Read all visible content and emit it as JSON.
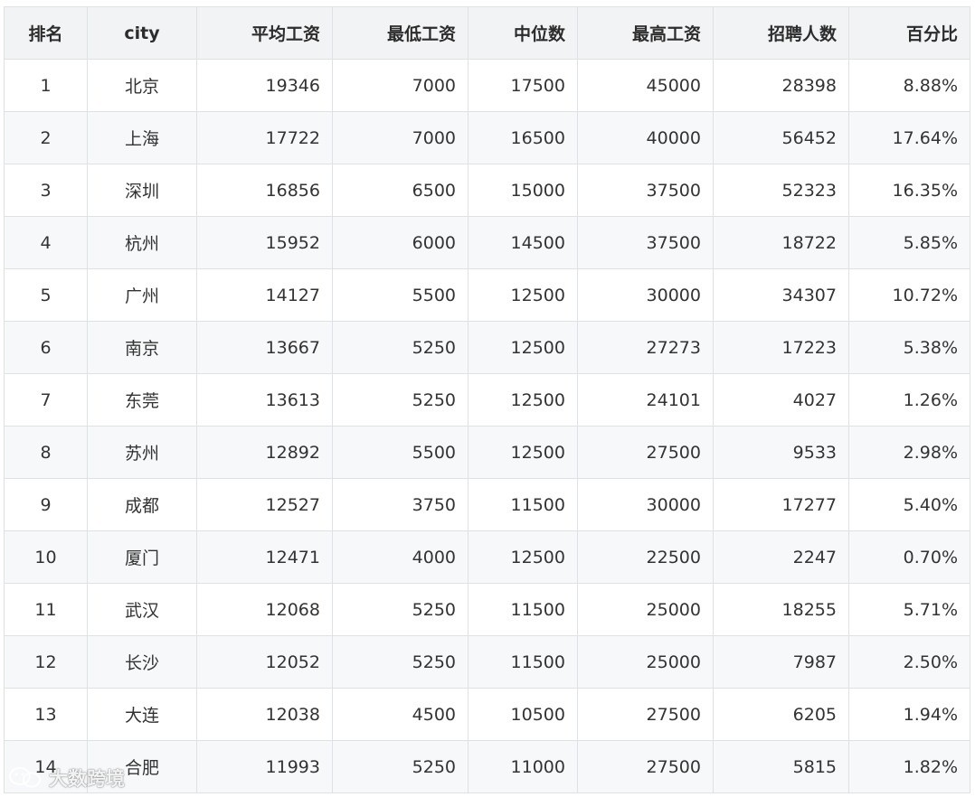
{
  "table": {
    "headers": [
      "排名",
      "city",
      "平均工资",
      "最低工资",
      "中位数",
      "最高工资",
      "招聘人数",
      "百分比"
    ],
    "rows": [
      [
        "1",
        "北京",
        "19346",
        "7000",
        "17500",
        "45000",
        "28398",
        "8.88%"
      ],
      [
        "2",
        "上海",
        "17722",
        "7000",
        "16500",
        "40000",
        "56452",
        "17.64%"
      ],
      [
        "3",
        "深圳",
        "16856",
        "6500",
        "15000",
        "37500",
        "52323",
        "16.35%"
      ],
      [
        "4",
        "杭州",
        "15952",
        "6000",
        "14500",
        "37500",
        "18722",
        "5.85%"
      ],
      [
        "5",
        "广州",
        "14127",
        "5500",
        "12500",
        "30000",
        "34307",
        "10.72%"
      ],
      [
        "6",
        "南京",
        "13667",
        "5250",
        "12500",
        "27273",
        "17223",
        "5.38%"
      ],
      [
        "7",
        "东莞",
        "13613",
        "5250",
        "12500",
        "24101",
        "4027",
        "1.26%"
      ],
      [
        "8",
        "苏州",
        "12892",
        "5500",
        "12500",
        "27500",
        "9533",
        "2.98%"
      ],
      [
        "9",
        "成都",
        "12527",
        "3750",
        "11500",
        "30000",
        "17277",
        "5.40%"
      ],
      [
        "10",
        "厦门",
        "12471",
        "4000",
        "12500",
        "22500",
        "2247",
        "0.70%"
      ],
      [
        "11",
        "武汉",
        "12068",
        "5250",
        "11500",
        "25000",
        "18255",
        "5.71%"
      ],
      [
        "12",
        "长沙",
        "12052",
        "5250",
        "11500",
        "25000",
        "7987",
        "2.50%"
      ],
      [
        "13",
        "大连",
        "12038",
        "4500",
        "10500",
        "27500",
        "6205",
        "1.94%"
      ],
      [
        "14",
        "合肥",
        "11993",
        "5250",
        "11000",
        "27500",
        "5815",
        "1.82%"
      ]
    ]
  },
  "watermark": {
    "text": "大数跨境",
    "icon": "wechat-logo-icon"
  }
}
